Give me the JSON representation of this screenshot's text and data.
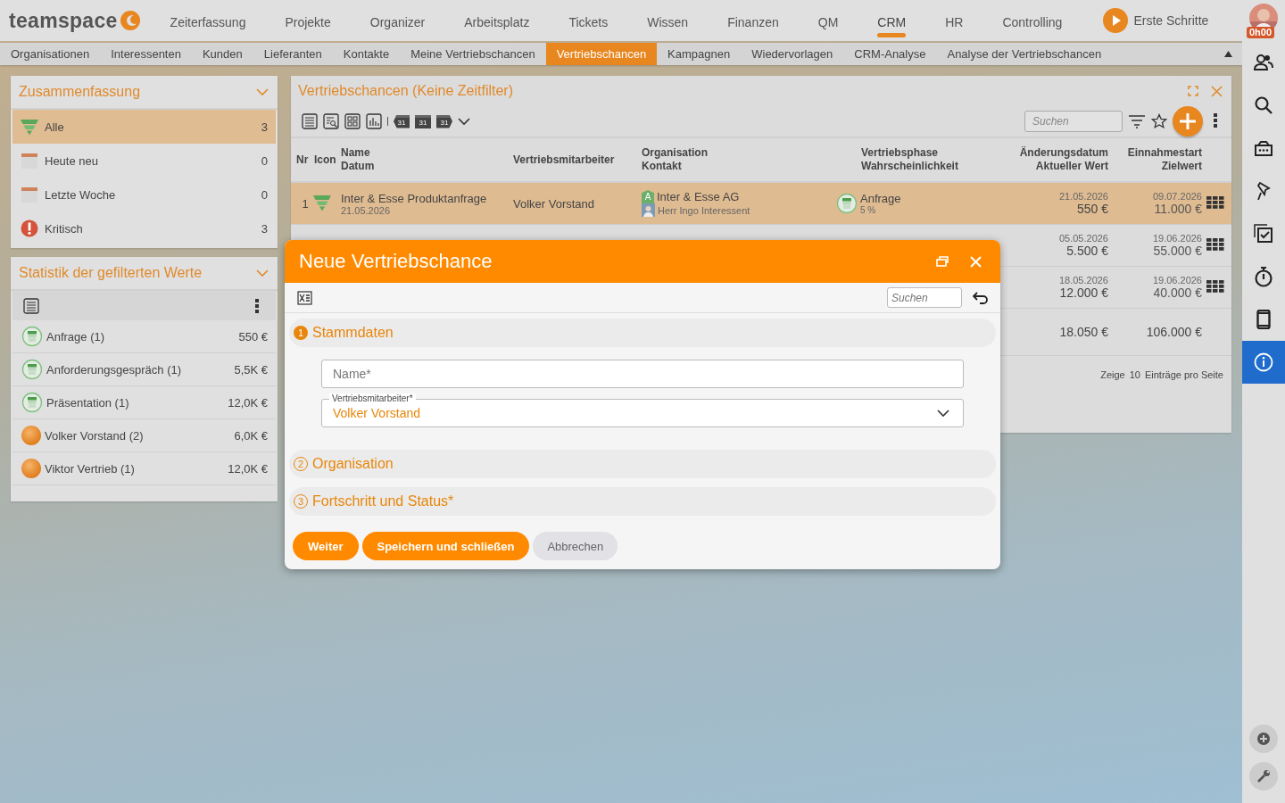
{
  "app": {
    "logo": "teamspace",
    "getting_started": "Erste Schritte",
    "user_badge": "0h00"
  },
  "main_nav": [
    {
      "label": "Zeiterfassung",
      "selected": false
    },
    {
      "label": "Projekte",
      "selected": false
    },
    {
      "label": "Organizer",
      "selected": false
    },
    {
      "label": "Arbeitsplatz",
      "selected": false
    },
    {
      "label": "Tickets",
      "selected": false
    },
    {
      "label": "Wissen",
      "selected": false
    },
    {
      "label": "Finanzen",
      "selected": false
    },
    {
      "label": "QM",
      "selected": false
    },
    {
      "label": "CRM",
      "selected": true
    },
    {
      "label": "HR",
      "selected": false
    },
    {
      "label": "Controlling",
      "selected": false
    }
  ],
  "sub_nav": [
    {
      "label": "Organisationen",
      "selected": false
    },
    {
      "label": "Interessenten",
      "selected": false
    },
    {
      "label": "Kunden",
      "selected": false
    },
    {
      "label": "Lieferanten",
      "selected": false
    },
    {
      "label": "Kontakte",
      "selected": false
    },
    {
      "label": "Meine Vertriebschancen",
      "selected": false
    },
    {
      "label": "Vertriebschancen",
      "selected": true
    },
    {
      "label": "Kampagnen",
      "selected": false
    },
    {
      "label": "Wiedervorlagen",
      "selected": false
    },
    {
      "label": "CRM-Analyse",
      "selected": false
    },
    {
      "label": "Analyse der Vertriebschancen",
      "selected": false
    }
  ],
  "summary": {
    "title": "Zusammenfassung",
    "items": [
      {
        "kind": "funnel",
        "label": "Alle",
        "count": "3",
        "selected": true
      },
      {
        "kind": "calendar",
        "label": "Heute neu",
        "count": "0",
        "selected": false
      },
      {
        "kind": "calendar",
        "label": "Letzte Woche",
        "count": "0",
        "selected": false
      },
      {
        "kind": "alert",
        "label": "Kritisch",
        "count": "3",
        "selected": false
      }
    ]
  },
  "statistics": {
    "title": "Statistik der gefilterten Werte",
    "items": [
      {
        "kind": "phase",
        "label": "Anfrage (1)",
        "value": "550 €"
      },
      {
        "kind": "phase",
        "label": "Anforderungsgespräch (1)",
        "value": "5,5K €"
      },
      {
        "kind": "phase",
        "label": "Präsentation (1)",
        "value": "12,0K €"
      },
      {
        "kind": "person",
        "label": "Volker Vorstand (2)",
        "value": "6,0K €"
      },
      {
        "kind": "person",
        "label": "Viktor Vertrieb (1)",
        "value": "12,0K €"
      }
    ]
  },
  "deals": {
    "title": "Vertriebschancen (Keine Zeitfilter)",
    "calendar_views": [
      {
        "kind": "previous",
        "day": "31"
      },
      {
        "kind": "current",
        "day": "31"
      },
      {
        "kind": "next",
        "day": "31"
      }
    ],
    "search": {
      "placeholder": "Suchen"
    },
    "columns": [
      {
        "lines": [
          "Nr"
        ]
      },
      {
        "lines": [
          "Icon"
        ]
      },
      {
        "lines": [
          "Name",
          "Datum"
        ]
      },
      {
        "lines": [
          "Vertriebsmitarbeiter"
        ]
      },
      {
        "lines": [
          "Organisation",
          "Kontakt"
        ]
      },
      {
        "lines": [
          "Vertriebsphase",
          "Wahrscheinlichkeit"
        ]
      },
      {
        "lines": [
          "Änderungsdatum",
          "Aktueller Wert"
        ]
      },
      {
        "lines": [
          "Einnahmestart",
          "Zielwert"
        ]
      }
    ],
    "rows": [
      {
        "selected": true,
        "nr": "1",
        "name": "Inter & Esse Produktanfrage",
        "date": "21.05.2026",
        "owner": "Volker Vorstand",
        "organisation": "Inter & Esse AG",
        "org_class": "A",
        "contact": "Herr Ingo Interessent",
        "phase": "Anfrage",
        "probability": "5 %",
        "changed": "21.05.2026",
        "current_value": "550 €",
        "revenue_start": "09.07.2026",
        "target_value": "11.000 €"
      },
      {
        "selected": false,
        "changed": "05.05.2026",
        "current_value": "5.500 €",
        "revenue_start": "19.06.2026",
        "target_value": "55.000 €"
      },
      {
        "selected": false,
        "changed": "18.05.2026",
        "current_value": "12.000 €",
        "revenue_start": "19.06.2026",
        "target_value": "40.000 €"
      }
    ],
    "totals": {
      "current_value": "18.050 €",
      "target_value": "106.000 €"
    },
    "footer": {
      "prefix": "Zeige",
      "page_size": "10",
      "suffix": "Einträge pro Seite"
    }
  },
  "modal": {
    "title": "Neue Vertriebschance",
    "search": {
      "placeholder": "Suchen"
    },
    "sections": [
      {
        "number": "1",
        "title": "Stammdaten",
        "expanded": true,
        "fields": [
          {
            "kind": "text",
            "placeholder": "Name*"
          },
          {
            "kind": "select",
            "label": "Vertriebsmitarbeiter*",
            "value": "Volker Vorstand"
          }
        ]
      },
      {
        "number": "2",
        "title": "Organisation",
        "expanded": false
      },
      {
        "number": "3",
        "title": "Fortschritt und Status*",
        "expanded": false
      }
    ],
    "buttons": [
      {
        "label": "Weiter",
        "kind": "primary"
      },
      {
        "label": "Speichern und schließen",
        "kind": "primary"
      },
      {
        "label": "Abbrechen",
        "kind": "secondary"
      }
    ]
  },
  "right_rail": [
    {
      "kind": "people",
      "selected": false
    },
    {
      "kind": "search",
      "selected": false
    },
    {
      "kind": "card",
      "selected": false
    },
    {
      "kind": "pin",
      "selected": false
    },
    {
      "kind": "checklist",
      "selected": false
    },
    {
      "kind": "stopwatch",
      "selected": false
    },
    {
      "kind": "phone",
      "selected": false
    },
    {
      "kind": "info",
      "selected": true
    }
  ],
  "rail_tools": [
    {
      "kind": "add"
    },
    {
      "kind": "wrench"
    }
  ]
}
